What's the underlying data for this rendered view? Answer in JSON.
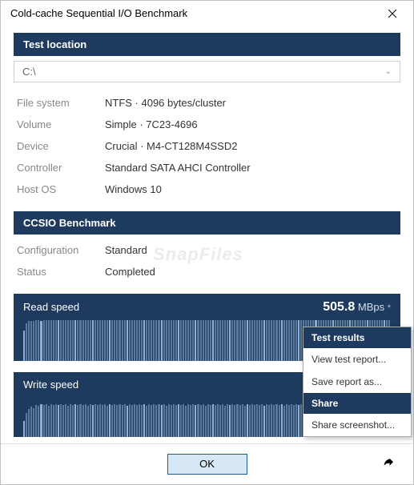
{
  "window": {
    "title": "Cold-cache Sequential I/O Benchmark"
  },
  "sections": {
    "test_location": {
      "header": "Test location",
      "combo_value": "C:\\"
    },
    "info": [
      {
        "label": "File system",
        "value": "NTFS  ·  4096 bytes/cluster"
      },
      {
        "label": "Volume",
        "value": "Simple  ·  7C23-4696"
      },
      {
        "label": "Device",
        "value": "Crucial  ·  M4-CT128M4SSD2"
      },
      {
        "label": "Controller",
        "value": "Standard SATA AHCI Controller"
      },
      {
        "label": "Host OS",
        "value": "Windows 10"
      }
    ],
    "benchmark": {
      "header": "CCSIO Benchmark",
      "rows": [
        {
          "label": "Configuration",
          "value": "Standard"
        },
        {
          "label": "Status",
          "value": "Completed"
        }
      ]
    },
    "read": {
      "label": "Read speed",
      "value": "505.8",
      "unit": "MBps",
      "star": "*"
    },
    "write": {
      "label": "Write speed"
    }
  },
  "popup": {
    "sect1": "Test results",
    "item1": "View test report...",
    "item2": "Save report as...",
    "sect2": "Share",
    "item3": "Share screenshot..."
  },
  "footer": {
    "ok": "OK"
  },
  "watermark": "SnapFiles",
  "chart_data": [
    {
      "type": "bar",
      "title": "Read speed",
      "ylabel": "MBps",
      "ylim": [
        0,
        520
      ],
      "values": [
        380,
        470,
        500,
        495,
        498,
        505,
        502,
        500,
        503,
        506,
        504,
        502,
        505,
        503,
        506,
        504,
        505,
        502,
        506,
        503,
        505,
        504,
        502,
        505,
        503,
        506,
        504,
        505,
        502,
        506,
        503,
        505,
        504,
        502,
        505,
        503,
        506,
        504,
        505,
        502,
        506,
        503,
        505,
        504,
        502,
        505,
        503,
        506,
        504,
        505,
        502,
        506,
        503,
        505,
        504,
        502,
        505,
        503,
        506,
        504,
        505,
        502,
        506,
        503,
        505,
        504,
        502,
        505,
        503,
        506,
        504,
        505,
        502,
        506,
        503,
        505,
        504,
        502,
        505,
        503,
        506,
        504,
        505,
        502,
        506,
        503,
        505,
        504,
        502,
        505,
        503,
        506,
        504,
        505,
        502,
        506,
        503,
        505,
        504,
        502,
        505,
        503,
        506,
        504,
        505,
        502,
        506,
        503,
        505,
        504,
        502,
        505,
        503,
        506,
        504,
        505,
        502,
        506,
        503,
        505,
        504,
        502,
        505,
        503,
        506,
        504,
        505,
        502,
        506,
        503,
        505,
        504,
        502,
        505,
        503,
        506,
        504,
        505,
        502,
        506,
        503,
        505,
        504,
        502,
        505,
        503,
        506,
        504,
        505,
        502
      ]
    },
    {
      "type": "bar",
      "title": "Write speed",
      "ylabel": "MBps",
      "ylim": [
        0,
        520
      ],
      "values": [
        200,
        300,
        350,
        380,
        360,
        400,
        390,
        410,
        395,
        405,
        388,
        402,
        396,
        408,
        392,
        404,
        398,
        406,
        390,
        402,
        396,
        408,
        392,
        404,
        398,
        406,
        390,
        402,
        396,
        408,
        392,
        404,
        398,
        406,
        390,
        402,
        396,
        408,
        392,
        404,
        398,
        406,
        390,
        402,
        396,
        408,
        392,
        404,
        398,
        406,
        390,
        402,
        396,
        408,
        392,
        404,
        398,
        406,
        390,
        402,
        396,
        408,
        392,
        404,
        398,
        406,
        390,
        402,
        396,
        408,
        392,
        404,
        398,
        406,
        390,
        402,
        396,
        408,
        392,
        404,
        398,
        406,
        390,
        402,
        396,
        408,
        392,
        404,
        398,
        406,
        390,
        402,
        396,
        408,
        392,
        404,
        398,
        406,
        390,
        402,
        396,
        408,
        392,
        404,
        398,
        406,
        390,
        402,
        396,
        408,
        392,
        404,
        398,
        406,
        390,
        402,
        396,
        408,
        392,
        404,
        398,
        406,
        390,
        402,
        396,
        408,
        392,
        404,
        398,
        406,
        390,
        402,
        396,
        408,
        392,
        404,
        398,
        406,
        390,
        402,
        396,
        408,
        392,
        404,
        398,
        406,
        390,
        402,
        396,
        408
      ]
    }
  ]
}
